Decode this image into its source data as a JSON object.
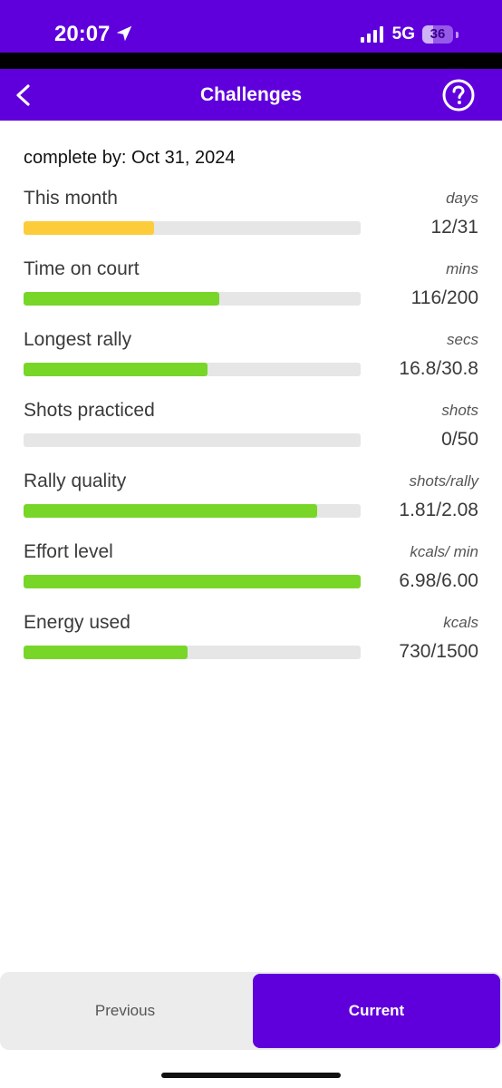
{
  "status_bar": {
    "time": "20:07",
    "network": "5G",
    "battery": "36",
    "battery_level_percent": 36,
    "location_icon": "location-arrow-icon",
    "signal_icon": "cellular-signal-icon"
  },
  "header": {
    "title": "Challenges",
    "back_icon": "chevron-left-icon",
    "help_icon": "help-circle-icon"
  },
  "challenge": {
    "complete_by": "complete by: Oct 31, 2024"
  },
  "metrics": [
    {
      "label": "This month",
      "unit": "days",
      "value": "12/31",
      "progress": 0.387,
      "color": "#fccc3a"
    },
    {
      "label": "Time on court",
      "unit": "mins",
      "value": "116/200",
      "progress": 0.58,
      "color": "#78d628"
    },
    {
      "label": "Longest rally",
      "unit": "secs",
      "value": "16.8/30.8",
      "progress": 0.545,
      "color": "#78d628"
    },
    {
      "label": "Shots practiced",
      "unit": "shots",
      "value": "0/50",
      "progress": 0,
      "color": "#78d628"
    },
    {
      "label": "Rally quality",
      "unit": "shots/rally",
      "value": "1.81/2.08",
      "progress": 0.87,
      "color": "#78d628"
    },
    {
      "label": "Effort level",
      "unit": "kcals/ min",
      "value": "6.98/6.00",
      "progress": 1.0,
      "color": "#78d628"
    },
    {
      "label": "Energy used",
      "unit": "kcals",
      "value": "730/1500",
      "progress": 0.487,
      "color": "#78d628"
    }
  ],
  "tabs": {
    "previous": "Previous",
    "current": "Current",
    "active": "current"
  },
  "colors": {
    "brand": "#5f00dc",
    "track": "#e6e6e6",
    "progress_green": "#78d628",
    "progress_yellow": "#fccc3a"
  }
}
